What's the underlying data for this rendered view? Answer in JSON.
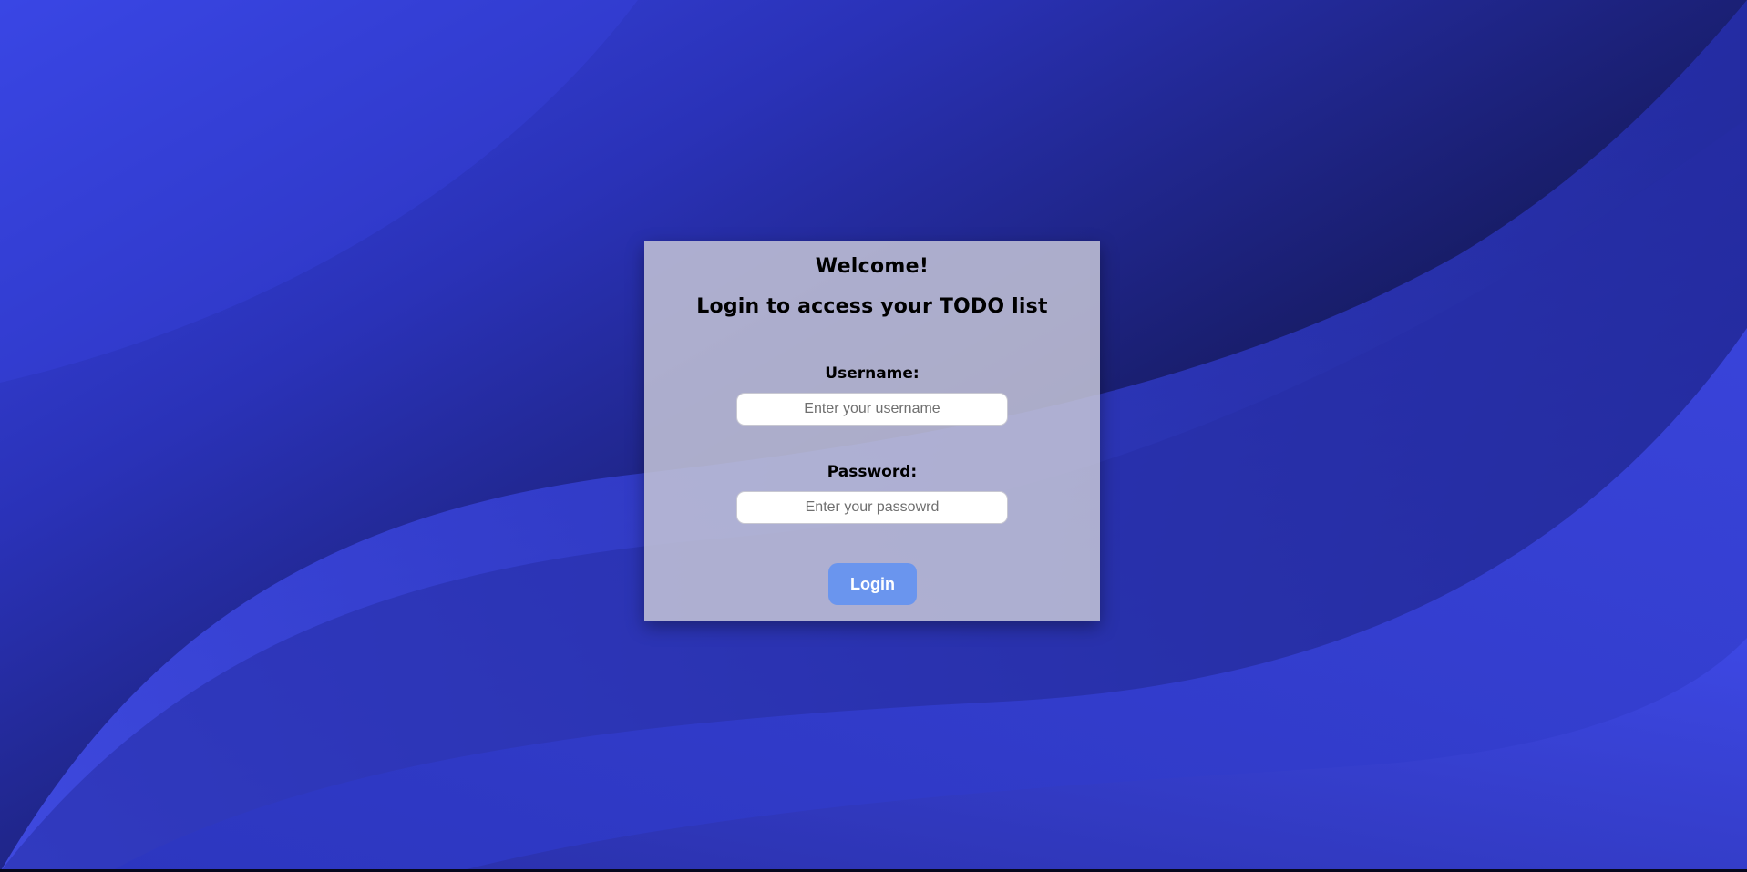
{
  "login": {
    "title": "Welcome!",
    "subtitle": "Login to access your TODO list",
    "username_label": "Username:",
    "username_placeholder": "Enter your username",
    "password_label": "Password:",
    "password_placeholder": "Enter your passowrd",
    "button_label": "Login"
  },
  "colors": {
    "background_light_blue": "#3a47e6",
    "background_dark_navy": "#0b0e2c",
    "card_background": "#c4c4d6",
    "button_background": "#6a95ee",
    "button_text": "#ffffff"
  }
}
